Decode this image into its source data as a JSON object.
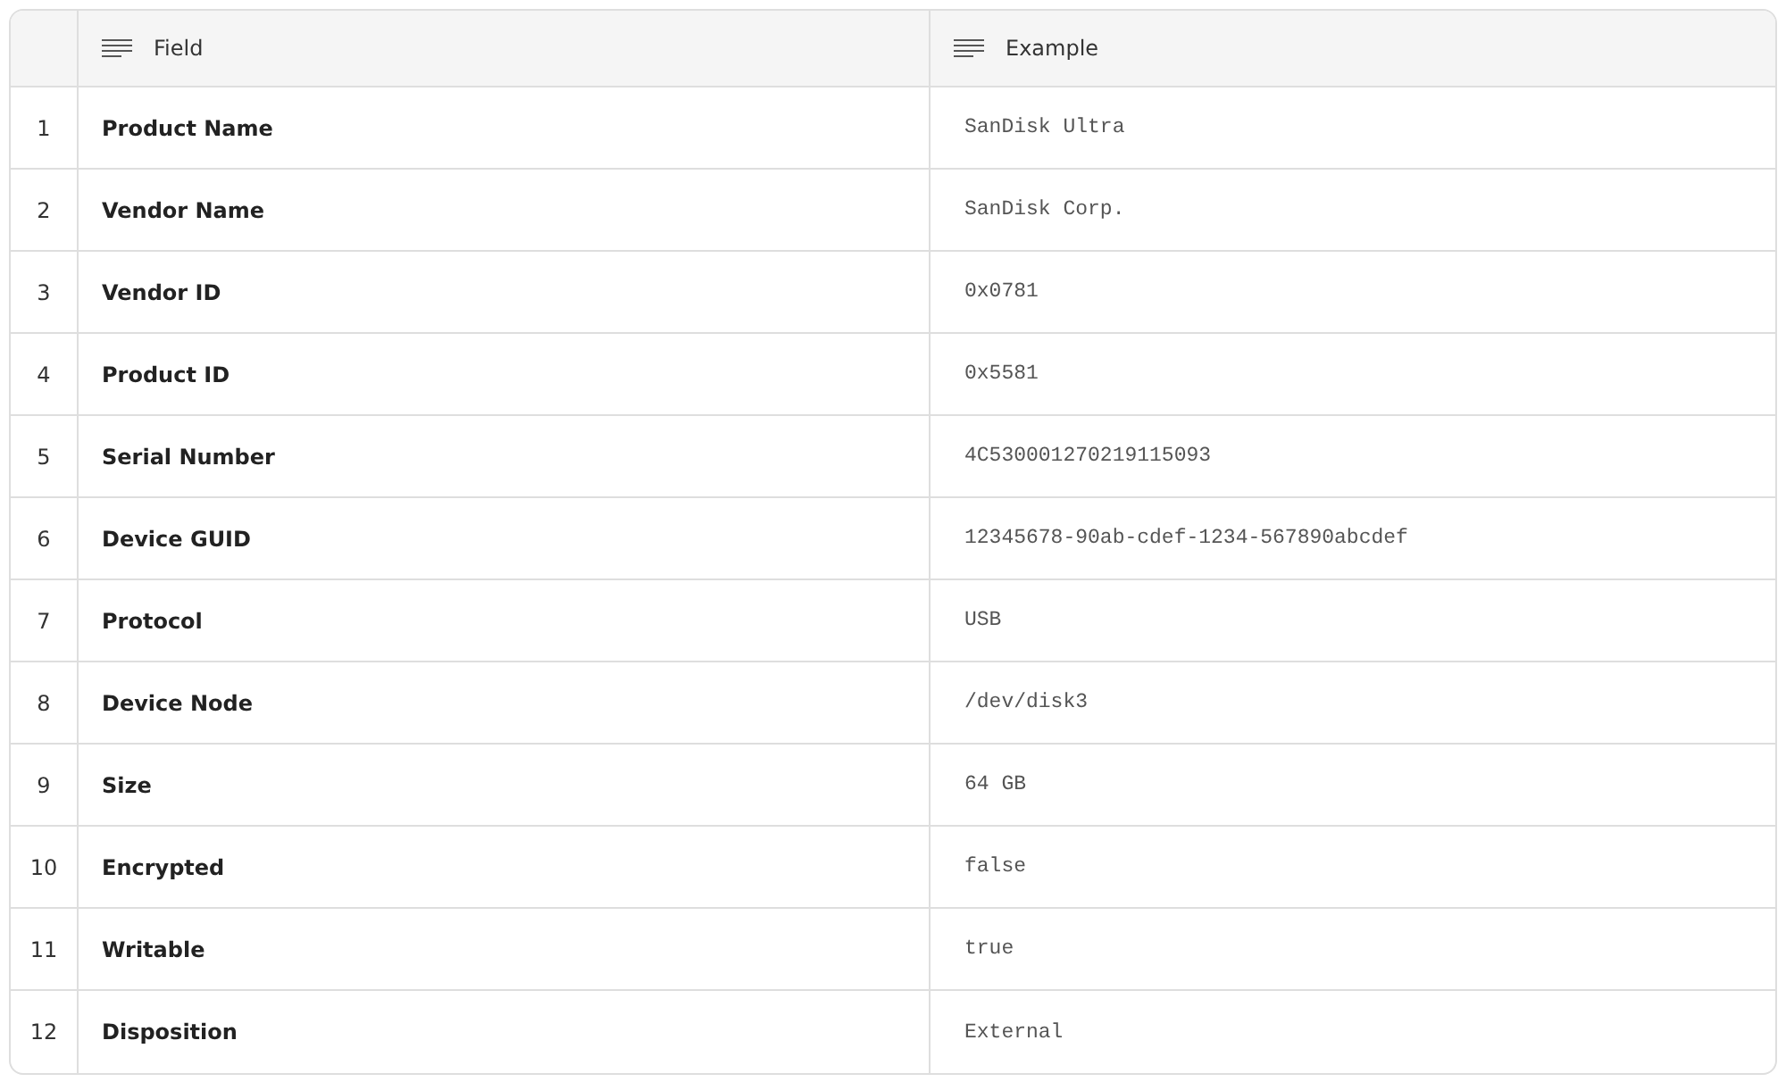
{
  "table": {
    "columns": [
      {
        "label": "Field"
      },
      {
        "label": "Example"
      }
    ],
    "rows": [
      {
        "index": "1",
        "field": "Product Name",
        "example": "SanDisk Ultra"
      },
      {
        "index": "2",
        "field": "Vendor Name",
        "example": "SanDisk Corp."
      },
      {
        "index": "3",
        "field": "Vendor ID",
        "example": "0x0781"
      },
      {
        "index": "4",
        "field": "Product ID",
        "example": "0x5581"
      },
      {
        "index": "5",
        "field": "Serial Number",
        "example": "4C530001270219115093"
      },
      {
        "index": "6",
        "field": "Device GUID",
        "example": "12345678-90ab-cdef-1234-567890abcdef"
      },
      {
        "index": "7",
        "field": "Protocol",
        "example": "USB"
      },
      {
        "index": "8",
        "field": "Device Node",
        "example": "/dev/disk3"
      },
      {
        "index": "9",
        "field": "Size",
        "example": "64 GB"
      },
      {
        "index": "10",
        "field": "Encrypted",
        "example": "false"
      },
      {
        "index": "11",
        "field": "Writable",
        "example": "true"
      },
      {
        "index": "12",
        "field": "Disposition",
        "example": "External"
      }
    ]
  }
}
